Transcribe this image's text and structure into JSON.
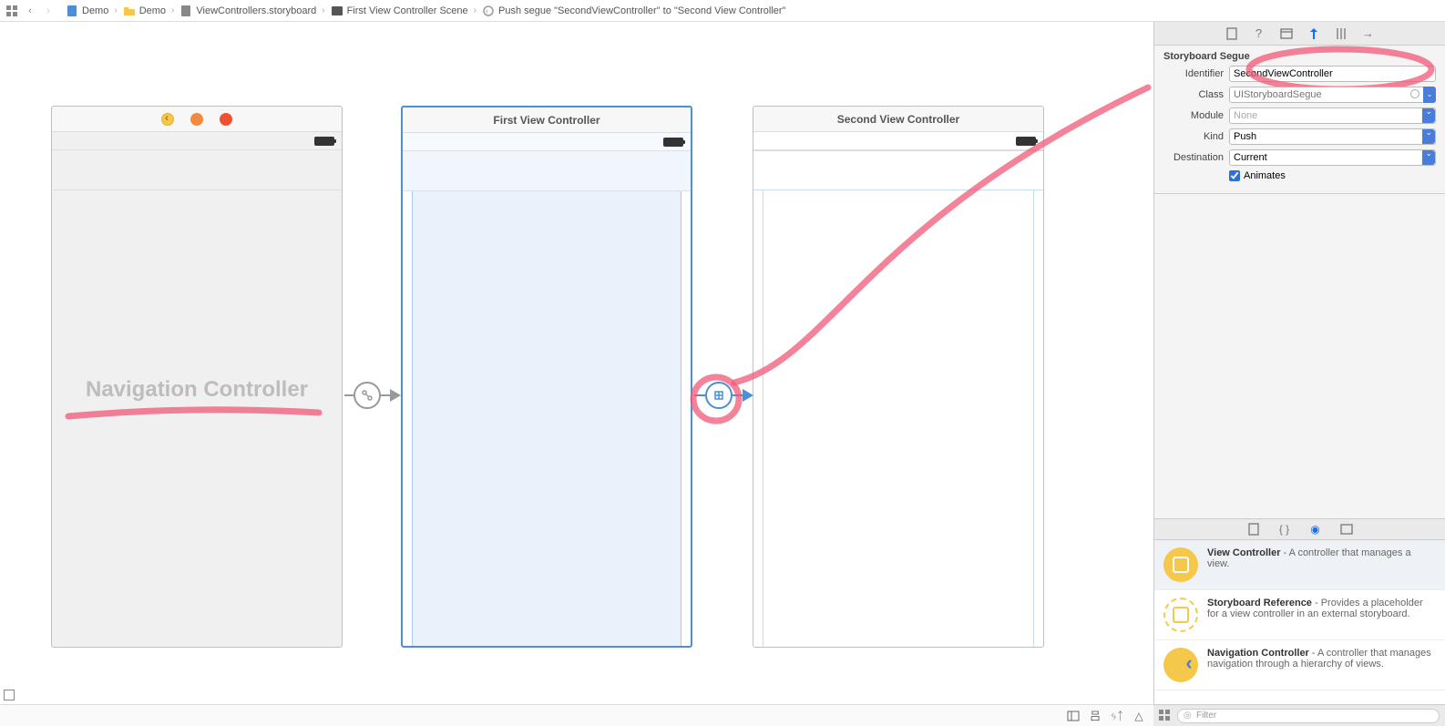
{
  "breadcrumb": {
    "items": [
      {
        "label": "Demo",
        "icon": "doc-blue"
      },
      {
        "label": "Demo",
        "icon": "folder-yellow"
      },
      {
        "label": "ViewControllers.storyboard",
        "icon": "doc-grey"
      },
      {
        "label": "First View Controller Scene",
        "icon": "frame-dark"
      },
      {
        "label": "Push segue \"SecondViewController\" to \"Second View Controller\"",
        "icon": "back-circle"
      }
    ]
  },
  "scenes": {
    "nav": {
      "label": "Navigation Controller"
    },
    "first": {
      "title": "First View Controller"
    },
    "second": {
      "title": "Second View Controller"
    }
  },
  "inspector": {
    "section": "Storyboard Segue",
    "identifier": {
      "label": "Identifier",
      "value": "SecondViewController"
    },
    "klass": {
      "label": "Class",
      "placeholder": "UIStoryboardSegue"
    },
    "module": {
      "label": "Module",
      "value": "None"
    },
    "kind": {
      "label": "Kind",
      "value": "Push"
    },
    "destination": {
      "label": "Destination",
      "value": "Current"
    },
    "animates": {
      "label": "Animates",
      "checked": true
    }
  },
  "library": {
    "items": [
      {
        "title": "View Controller",
        "desc": " - A controller that manages a view.",
        "badge": "yellow"
      },
      {
        "title": "Storyboard Reference",
        "desc": " - Provides a placeholder for a view controller in an external storyboard.",
        "badge": "outline"
      },
      {
        "title": "Navigation Controller",
        "desc": " - A controller that manages navigation through a hierarchy of views.",
        "badge": "back"
      }
    ],
    "filter_placeholder": "Filter"
  }
}
